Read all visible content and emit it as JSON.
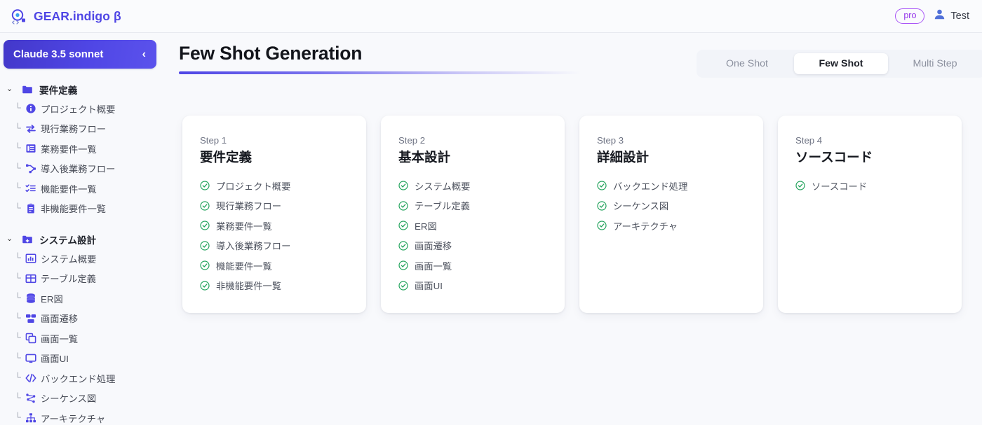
{
  "brand": {
    "name": "GEAR.indigo β",
    "logo_icon": "target-logo-icon"
  },
  "topbar": {
    "pro_badge": "pro",
    "user_name": "Test",
    "user_icon": "user-avatar-icon"
  },
  "sidebar": {
    "model_button": {
      "label": "Claude 3.5 sonnet",
      "chevron": "‹"
    },
    "groups": [
      {
        "label": "要件定義",
        "icon": "folder-icon",
        "caret": "⌄",
        "items": [
          {
            "label": "プロジェクト概要",
            "icon": "info-circle-icon"
          },
          {
            "label": "現行業務フロー",
            "icon": "swap-arrows-icon"
          },
          {
            "label": "業務要件一覧",
            "icon": "list-panel-icon"
          },
          {
            "label": "導入後業務フロー",
            "icon": "flow-branch-icon"
          },
          {
            "label": "機能要件一覧",
            "icon": "checklist-icon"
          },
          {
            "label": "非機能要件一覧",
            "icon": "clipboard-icon"
          }
        ]
      },
      {
        "label": "システム設計",
        "icon": "folder-plus-icon",
        "caret": "⌄",
        "items": [
          {
            "label": "システム概要",
            "icon": "bar-chart-icon"
          },
          {
            "label": "テーブル定義",
            "icon": "table-grid-icon"
          },
          {
            "label": "ER図",
            "icon": "database-icon"
          },
          {
            "label": "画面遷移",
            "icon": "screen-transition-icon"
          },
          {
            "label": "画面一覧",
            "icon": "copy-windows-icon"
          },
          {
            "label": "画面UI",
            "icon": "monitor-icon"
          },
          {
            "label": "バックエンド処理",
            "icon": "code-brackets-icon"
          },
          {
            "label": "シーケンス図",
            "icon": "sequence-nodes-icon"
          },
          {
            "label": "アーキテクチャ",
            "icon": "hierarchy-icon"
          }
        ]
      }
    ]
  },
  "main": {
    "page_title": "Few Shot Generation",
    "tabs": [
      {
        "label": "One Shot",
        "active": false
      },
      {
        "label": "Few Shot",
        "active": true
      },
      {
        "label": "Multi Step",
        "active": false
      }
    ],
    "cards": [
      {
        "step": "Step 1",
        "title": "要件定義",
        "items": [
          "プロジェクト概要",
          "現行業務フロー",
          "業務要件一覧",
          "導入後業務フロー",
          "機能要件一覧",
          "非機能要件一覧"
        ]
      },
      {
        "step": "Step 2",
        "title": "基本設計",
        "items": [
          "システム概要",
          "テーブル定義",
          "ER図",
          "画面遷移",
          "画面一覧",
          "画面UI"
        ]
      },
      {
        "step": "Step 3",
        "title": "詳細設計",
        "items": [
          "バックエンド処理",
          "シーケンス図",
          "アーキテクチャ"
        ]
      },
      {
        "step": "Step 4",
        "title": "ソースコード",
        "items": [
          "ソースコード"
        ]
      }
    ]
  },
  "colors": {
    "accent": "#4f46e5",
    "accent_dark": "#4338ca",
    "pro_purple": "#9333ea",
    "check_green": "#22a35c",
    "page_bg": "#f8f9fc",
    "card_bg": "#ffffff"
  }
}
